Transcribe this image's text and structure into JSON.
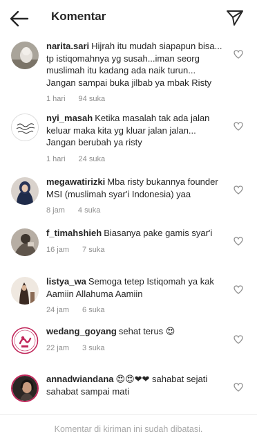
{
  "header": {
    "title": "Komentar",
    "back_icon": "arrow-left-icon",
    "share_icon": "paper-plane-icon"
  },
  "comments": [
    {
      "username": "narita.sari",
      "text": "Hijrah itu mudah siapapun bisa... tp istiqomahnya yg susah...iman seorg muslimah itu kadang ada naik turun... Jangan sampai buka jilbab ya mbak Risty",
      "time": "1 hari",
      "likes": "94 suka"
    },
    {
      "username": "nyi_masah",
      "text": "Ketika masalah tak ada jalan keluar maka kita yg kluar jalan jalan... Jangan berubah ya risty",
      "time": "1 hari",
      "likes": "24 suka"
    },
    {
      "username": "megawatirizki",
      "text": "Mba risty bukannya founder MSI (muslimah syar'i Indonesia) yaa",
      "time": "8 jam",
      "likes": "4 suka"
    },
    {
      "username": "f_timahshieh",
      "text": "Biasanya pake gamis syar'i",
      "time": "16 jam",
      "likes": "7 suka"
    },
    {
      "username": "listya_wa",
      "text": "Semoga tetep Istiqomah ya kak Aamiin Allahuma Aamiin",
      "time": "24 jam",
      "likes": "6 suka"
    },
    {
      "username": "wedang_goyang",
      "text": "sehat terus 😍",
      "time": "22 jam",
      "likes": "3 suka"
    },
    {
      "username": "annadwiandana",
      "text": "😍😍❤❤ sahabat sejati sahabat sampai mati",
      "time": "",
      "likes": ""
    }
  ],
  "avatar_texts": {
    "wedang_logo": "wedang goyang"
  },
  "footer": {
    "text": "Komentar di kiriman ini sudah dibatasi."
  },
  "colors": {
    "text": "#262626",
    "meta": "#8e8e8e",
    "footer_text": "#a8a8a8",
    "wedang_ring": "#c0265a"
  }
}
